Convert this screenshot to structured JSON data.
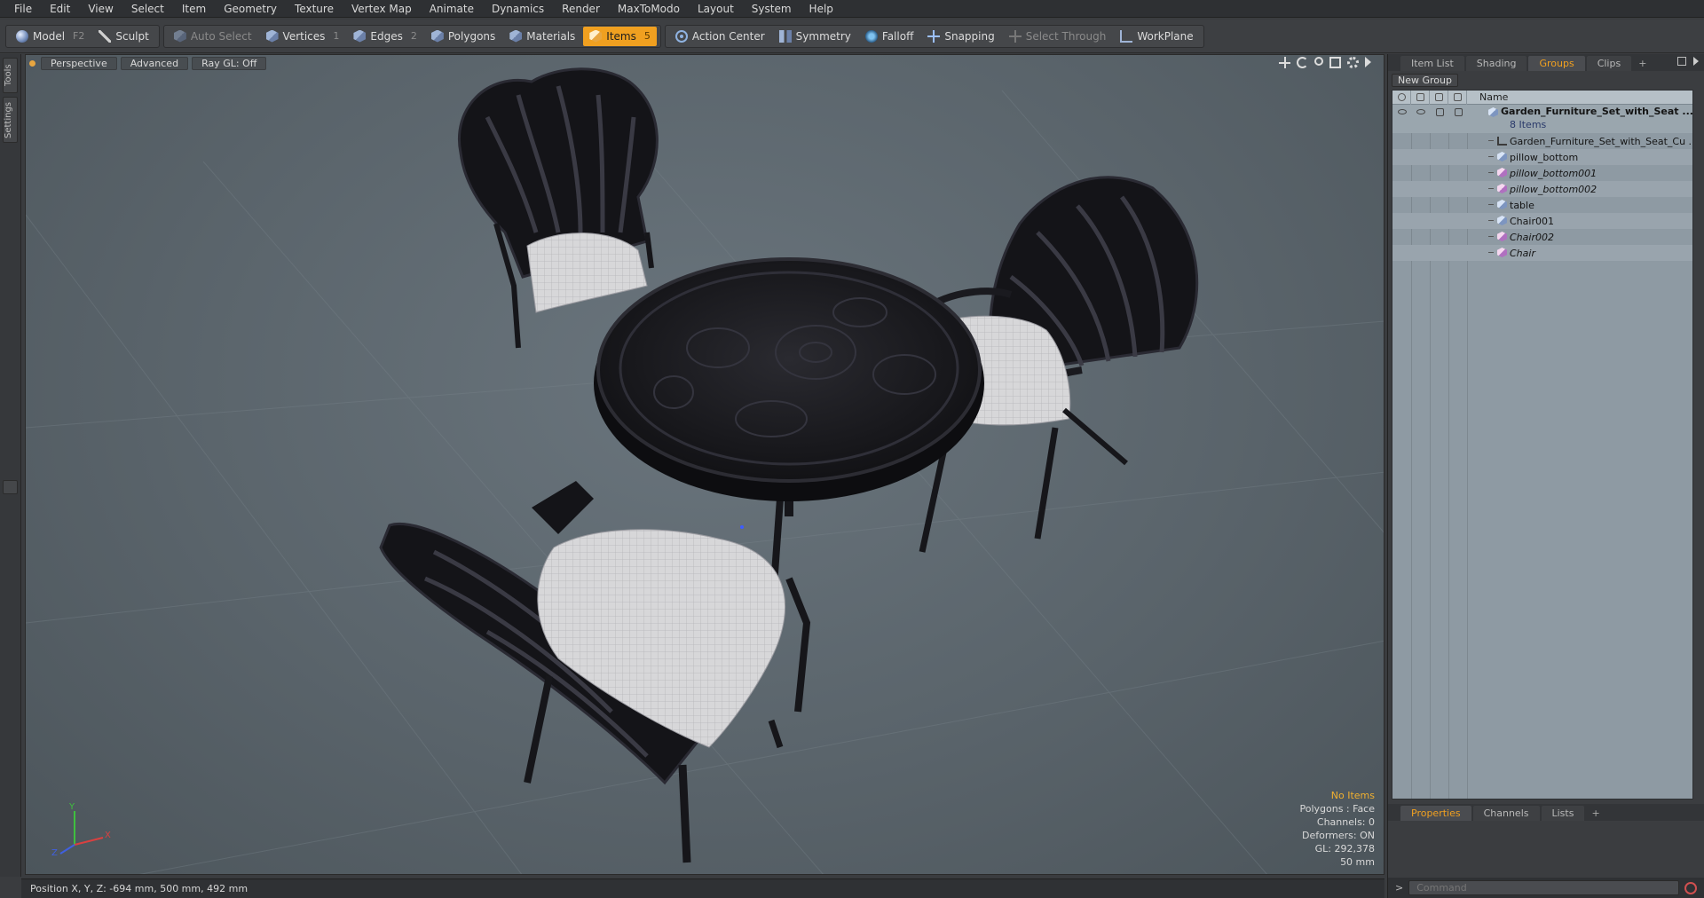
{
  "menu": [
    "File",
    "Edit",
    "View",
    "Select",
    "Item",
    "Geometry",
    "Texture",
    "Vertex Map",
    "Animate",
    "Dynamics",
    "Render",
    "MaxToModo",
    "Layout",
    "System",
    "Help"
  ],
  "toolbar": {
    "model": "Model",
    "model_key": "F2",
    "sculpt": "Sculpt",
    "auto_select": "Auto Select",
    "vertices": "Vertices",
    "vertices_key": "1",
    "edges": "Edges",
    "edges_key": "2",
    "polygons": "Polygons",
    "materials": "Materials",
    "items": "Items",
    "items_key": "5",
    "action_center": "Action Center",
    "symmetry": "Symmetry",
    "falloff": "Falloff",
    "snapping": "Snapping",
    "select_through": "Select Through",
    "workplane": "WorkPlane",
    "active_color": "#f0a020"
  },
  "left_tabs": [
    "Tools",
    "Settings"
  ],
  "viewport": {
    "view": "Perspective",
    "shading": "Advanced",
    "raygl": "Ray GL: Off",
    "info": {
      "selection": "No Items",
      "polygons": "Polygons : Face",
      "channels": "Channels: 0",
      "deformers": "Deformers: ON",
      "gl": "GL: 292,378",
      "scale": "50 mm"
    }
  },
  "status": {
    "position": "Position X, Y, Z:  -694 mm, 500 mm, 492 mm"
  },
  "right_panel": {
    "tabs": [
      "Item List",
      "Shading",
      "Groups",
      "Clips"
    ],
    "active_tab": "Groups",
    "new_group": "New Group",
    "name_header": "Name",
    "group": {
      "name": "Garden_Furniture_Set_with_Seat ...",
      "count": "8 Items"
    },
    "items": [
      {
        "name": "Garden_Furniture_Set_with_Seat_Cu ...",
        "icon": "locator-icon",
        "italic": false
      },
      {
        "name": "pillow_bottom",
        "icon": "mesh-icon",
        "italic": false
      },
      {
        "name": "pillow_bottom001",
        "icon": "mesh-instance-icon",
        "italic": true
      },
      {
        "name": "pillow_bottom002",
        "icon": "mesh-instance-icon",
        "italic": true
      },
      {
        "name": "table",
        "icon": "mesh-icon",
        "italic": false
      },
      {
        "name": "Chair001",
        "icon": "mesh-icon",
        "italic": false
      },
      {
        "name": "Chair002",
        "icon": "mesh-instance-icon",
        "italic": true
      },
      {
        "name": "Chair",
        "icon": "mesh-instance-icon",
        "italic": true
      }
    ],
    "bottom_tabs": [
      "Properties",
      "Channels",
      "Lists"
    ],
    "active_bottom_tab": "Properties",
    "command_placeholder": "Command"
  }
}
